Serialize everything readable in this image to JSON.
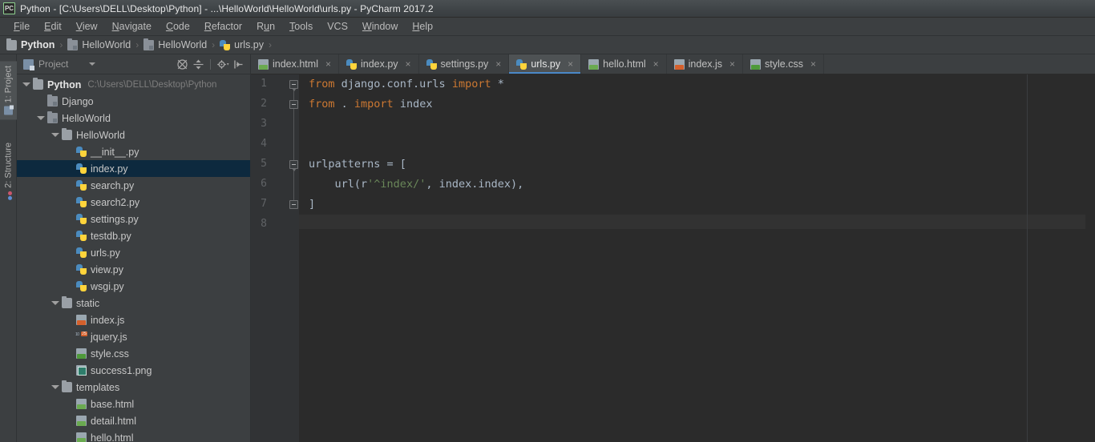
{
  "window": {
    "title": "Python - [C:\\Users\\DELL\\Desktop\\Python] - ...\\HelloWorld\\HelloWorld\\urls.py - PyCharm 2017.2",
    "app_icon": "pycharm-icon",
    "icon_text": "PC"
  },
  "menubar": {
    "items": [
      {
        "label": "File",
        "mnemonic": "F"
      },
      {
        "label": "Edit",
        "mnemonic": "E"
      },
      {
        "label": "View",
        "mnemonic": "V"
      },
      {
        "label": "Navigate",
        "mnemonic": "N"
      },
      {
        "label": "Code",
        "mnemonic": "C"
      },
      {
        "label": "Refactor",
        "mnemonic": "R"
      },
      {
        "label": "Run",
        "mnemonic": "u"
      },
      {
        "label": "Tools",
        "mnemonic": "T"
      },
      {
        "label": "VCS",
        "mnemonic": ""
      },
      {
        "label": "Window",
        "mnemonic": "W"
      },
      {
        "label": "Help",
        "mnemonic": "H"
      }
    ]
  },
  "breadcrumb": {
    "separator": "›",
    "items": [
      {
        "label": "Python",
        "icon": "folder-icon"
      },
      {
        "label": "HelloWorld",
        "icon": "source-folder-icon"
      },
      {
        "label": "HelloWorld",
        "icon": "source-folder-icon"
      },
      {
        "label": "urls.py",
        "icon": "python-file-icon"
      }
    ]
  },
  "tool_window_strip": {
    "tabs": [
      {
        "label": "1: Project",
        "icon": "project-icon",
        "active": true
      },
      {
        "label": "2: Structure",
        "icon": "structure-icon",
        "active": false
      }
    ]
  },
  "project_panel": {
    "header": {
      "title": "Project",
      "icon": "project-icon",
      "dropdown_icon": "chevron-down-icon",
      "tools": [
        {
          "name": "collapse-all-icon"
        },
        {
          "name": "expand-all-icon"
        },
        {
          "name": "settings-gear-icon"
        },
        {
          "name": "hide-panel-icon"
        }
      ]
    },
    "tree": [
      {
        "label": "Python",
        "path": "C:\\Users\\DELL\\Desktop\\Python",
        "depth": 0,
        "type": "folder",
        "expanded": true,
        "selected": false,
        "bold": true
      },
      {
        "label": "Django",
        "path": "",
        "depth": 1,
        "type": "source-folder",
        "expanded": false,
        "selected": false,
        "bold": false
      },
      {
        "label": "HelloWorld",
        "path": "",
        "depth": 1,
        "type": "source-folder",
        "expanded": true,
        "selected": false,
        "bold": false
      },
      {
        "label": "HelloWorld",
        "path": "",
        "depth": 2,
        "type": "folder",
        "expanded": true,
        "selected": false,
        "bold": false
      },
      {
        "label": "__init__.py",
        "path": "",
        "depth": 3,
        "type": "python",
        "expanded": false,
        "selected": false,
        "bold": false
      },
      {
        "label": "index.py",
        "path": "",
        "depth": 3,
        "type": "python",
        "expanded": false,
        "selected": true,
        "bold": false
      },
      {
        "label": "search.py",
        "path": "",
        "depth": 3,
        "type": "python",
        "expanded": false,
        "selected": false,
        "bold": false
      },
      {
        "label": "search2.py",
        "path": "",
        "depth": 3,
        "type": "python",
        "expanded": false,
        "selected": false,
        "bold": false
      },
      {
        "label": "settings.py",
        "path": "",
        "depth": 3,
        "type": "python",
        "expanded": false,
        "selected": false,
        "bold": false
      },
      {
        "label": "testdb.py",
        "path": "",
        "depth": 3,
        "type": "python",
        "expanded": false,
        "selected": false,
        "bold": false
      },
      {
        "label": "urls.py",
        "path": "",
        "depth": 3,
        "type": "python",
        "expanded": false,
        "selected": false,
        "bold": false
      },
      {
        "label": "view.py",
        "path": "",
        "depth": 3,
        "type": "python",
        "expanded": false,
        "selected": false,
        "bold": false
      },
      {
        "label": "wsgi.py",
        "path": "",
        "depth": 3,
        "type": "python",
        "expanded": false,
        "selected": false,
        "bold": false
      },
      {
        "label": "static",
        "path": "",
        "depth": 2,
        "type": "folder",
        "expanded": true,
        "selected": false,
        "bold": false
      },
      {
        "label": "index.js",
        "path": "",
        "depth": 3,
        "type": "js",
        "expanded": false,
        "selected": false,
        "bold": false
      },
      {
        "label": "jquery.js",
        "path": "",
        "depth": 3,
        "type": "jquery",
        "expanded": false,
        "selected": false,
        "bold": false
      },
      {
        "label": "style.css",
        "path": "",
        "depth": 3,
        "type": "css",
        "expanded": false,
        "selected": false,
        "bold": false
      },
      {
        "label": "success1.png",
        "path": "",
        "depth": 3,
        "type": "png",
        "expanded": false,
        "selected": false,
        "bold": false
      },
      {
        "label": "templates",
        "path": "",
        "depth": 2,
        "type": "folder",
        "expanded": true,
        "selected": false,
        "bold": false
      },
      {
        "label": "base.html",
        "path": "",
        "depth": 3,
        "type": "html",
        "expanded": false,
        "selected": false,
        "bold": false
      },
      {
        "label": "detail.html",
        "path": "",
        "depth": 3,
        "type": "html",
        "expanded": false,
        "selected": false,
        "bold": false
      },
      {
        "label": "hello.html",
        "path": "",
        "depth": 3,
        "type": "html",
        "expanded": false,
        "selected": false,
        "bold": false
      }
    ]
  },
  "editor_tabs": {
    "close_glyph": "×",
    "items": [
      {
        "label": "index.html",
        "icon": "html-file-icon",
        "active": false
      },
      {
        "label": "index.py",
        "icon": "python-file-icon",
        "active": false
      },
      {
        "label": "settings.py",
        "icon": "python-file-icon",
        "active": false
      },
      {
        "label": "urls.py",
        "icon": "python-file-icon",
        "active": true
      },
      {
        "label": "hello.html",
        "icon": "html-file-icon",
        "active": false
      },
      {
        "label": "index.js",
        "icon": "js-file-icon",
        "active": false
      },
      {
        "label": "style.css",
        "icon": "css-file-icon",
        "active": false
      }
    ]
  },
  "editor": {
    "filename": "urls.py",
    "language": "python",
    "line_numbers": [
      "1",
      "2",
      "3",
      "4",
      "5",
      "6",
      "7",
      "8"
    ],
    "caret_line": 8,
    "lines": [
      {
        "n": 1,
        "segments": [
          {
            "t": "from",
            "c": "kw"
          },
          {
            "t": " django.conf.urls ",
            "c": ""
          },
          {
            "t": "import",
            "c": "kw"
          },
          {
            "t": " *",
            "c": ""
          }
        ]
      },
      {
        "n": 2,
        "segments": [
          {
            "t": "from",
            "c": "kw"
          },
          {
            "t": " . ",
            "c": ""
          },
          {
            "t": "import",
            "c": "kw"
          },
          {
            "t": " index",
            "c": ""
          }
        ]
      },
      {
        "n": 3,
        "segments": []
      },
      {
        "n": 4,
        "segments": []
      },
      {
        "n": 5,
        "segments": [
          {
            "t": "urlpatterns = [",
            "c": ""
          }
        ]
      },
      {
        "n": 6,
        "segments": [
          {
            "t": "    url(",
            "c": ""
          },
          {
            "t": "r",
            "c": "pfx"
          },
          {
            "t": "'^index/'",
            "c": "str"
          },
          {
            "t": ", index.index),",
            "c": ""
          }
        ]
      },
      {
        "n": 7,
        "segments": [
          {
            "t": "]",
            "c": ""
          }
        ]
      },
      {
        "n": 8,
        "segments": []
      }
    ],
    "folds": [
      {
        "line": 1,
        "kind": "down"
      },
      {
        "line": 2,
        "kind": "flat"
      },
      {
        "line": 5,
        "kind": "down"
      },
      {
        "line": 7,
        "kind": "flat"
      }
    ]
  },
  "colors": {
    "chrome": "#3c3f41",
    "editor_bg": "#2b2b2b",
    "gutter_bg": "#313335",
    "text": "#a9b7c6",
    "keyword": "#cc7832",
    "string": "#6a8759",
    "selection": "#0d293e",
    "tab_active": "#4e5254",
    "tab_underline": "#4a88c7",
    "line_number": "#606366"
  }
}
